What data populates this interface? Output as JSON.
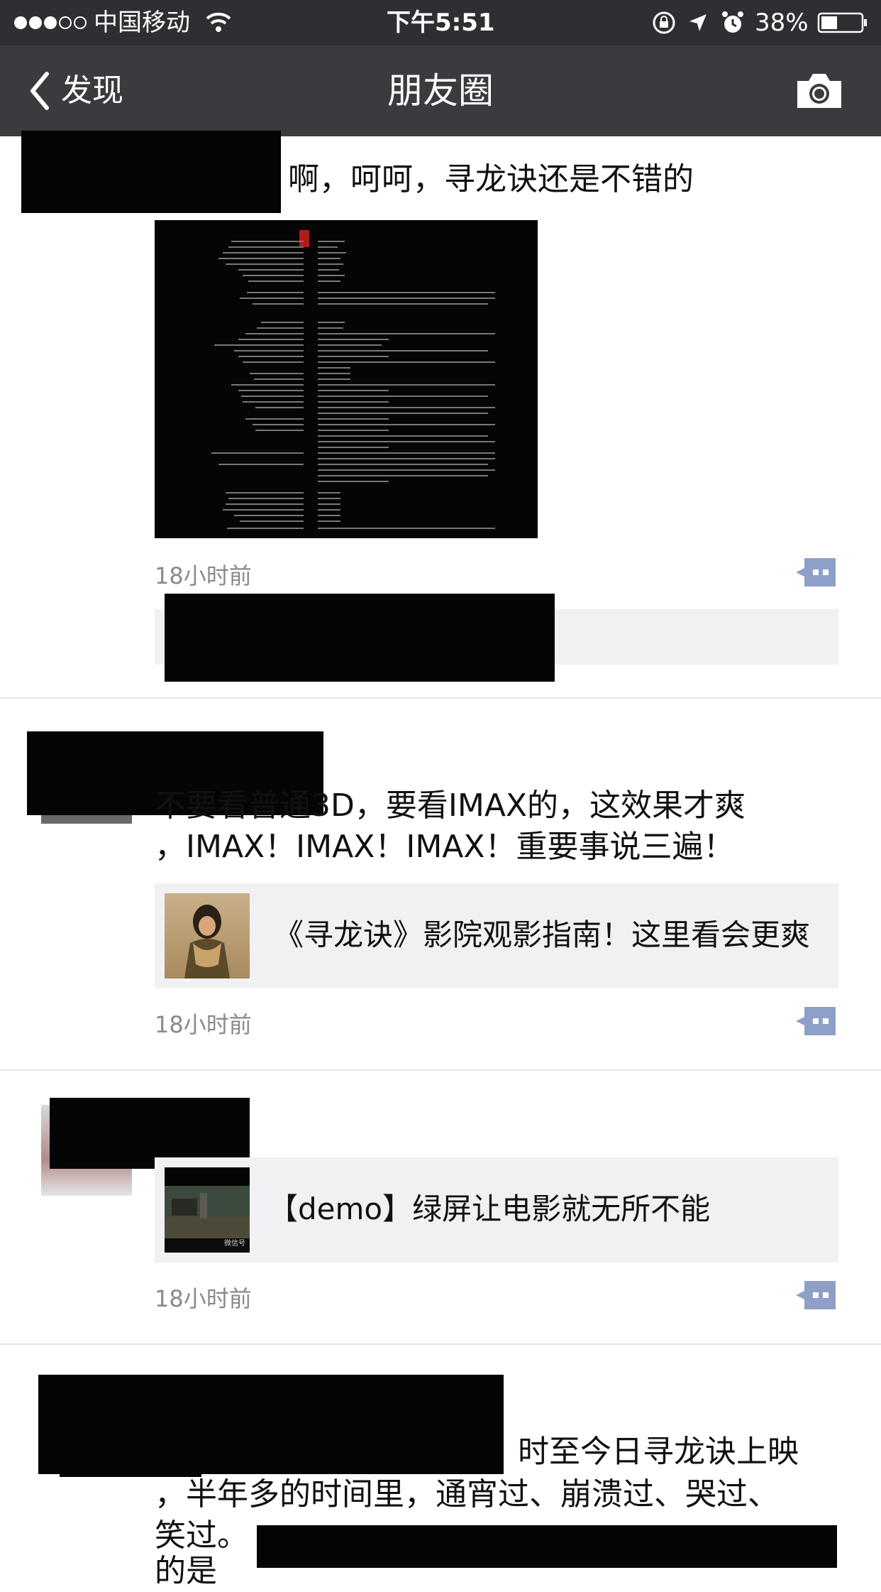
{
  "status_bar": {
    "carrier": "中国移动",
    "time": "下午5:51",
    "battery": "38%",
    "signal_icon": "signal-dots-icon",
    "wifi_icon": "wifi-icon",
    "lock_icon": "orientation-lock-icon",
    "location_icon": "location-arrow-icon",
    "alarm_icon": "alarm-icon",
    "battery_icon": "battery-icon"
  },
  "nav": {
    "back_label": "发现",
    "title": "朋友圈",
    "camera_icon": "camera-icon"
  },
  "posts": [
    {
      "text": "啊，呵呵，寻龙诀还是不错的",
      "time": "18小时前"
    },
    {
      "text_line1": "不要看普通3D，要看IMAX的，这效果才爽",
      "text_line2": "，IMAX！IMAX！IMAX！重要事说三遍！",
      "link_title": "《寻龙诀》影院观影指南！这里看会更爽",
      "time": "18小时前"
    },
    {
      "link_title": "【demo】绿屏让电影就无所不能",
      "thumb_watermark": "微信号",
      "time": "18小时前"
    },
    {
      "text_line1": "时至今日寻龙诀上映",
      "text_line2": "，半年多的时间里，通宵过、崩溃过、哭过、",
      "text_line3": "笑过。",
      "text_line4": "的是"
    }
  ],
  "colors": {
    "statusbar_bg": "#2e2e33",
    "navbar_bg": "#3a3a3f",
    "comment_button": "#8fa0c8",
    "link_card_bg": "#f1f1f3",
    "time_text": "#8a8a8a"
  }
}
